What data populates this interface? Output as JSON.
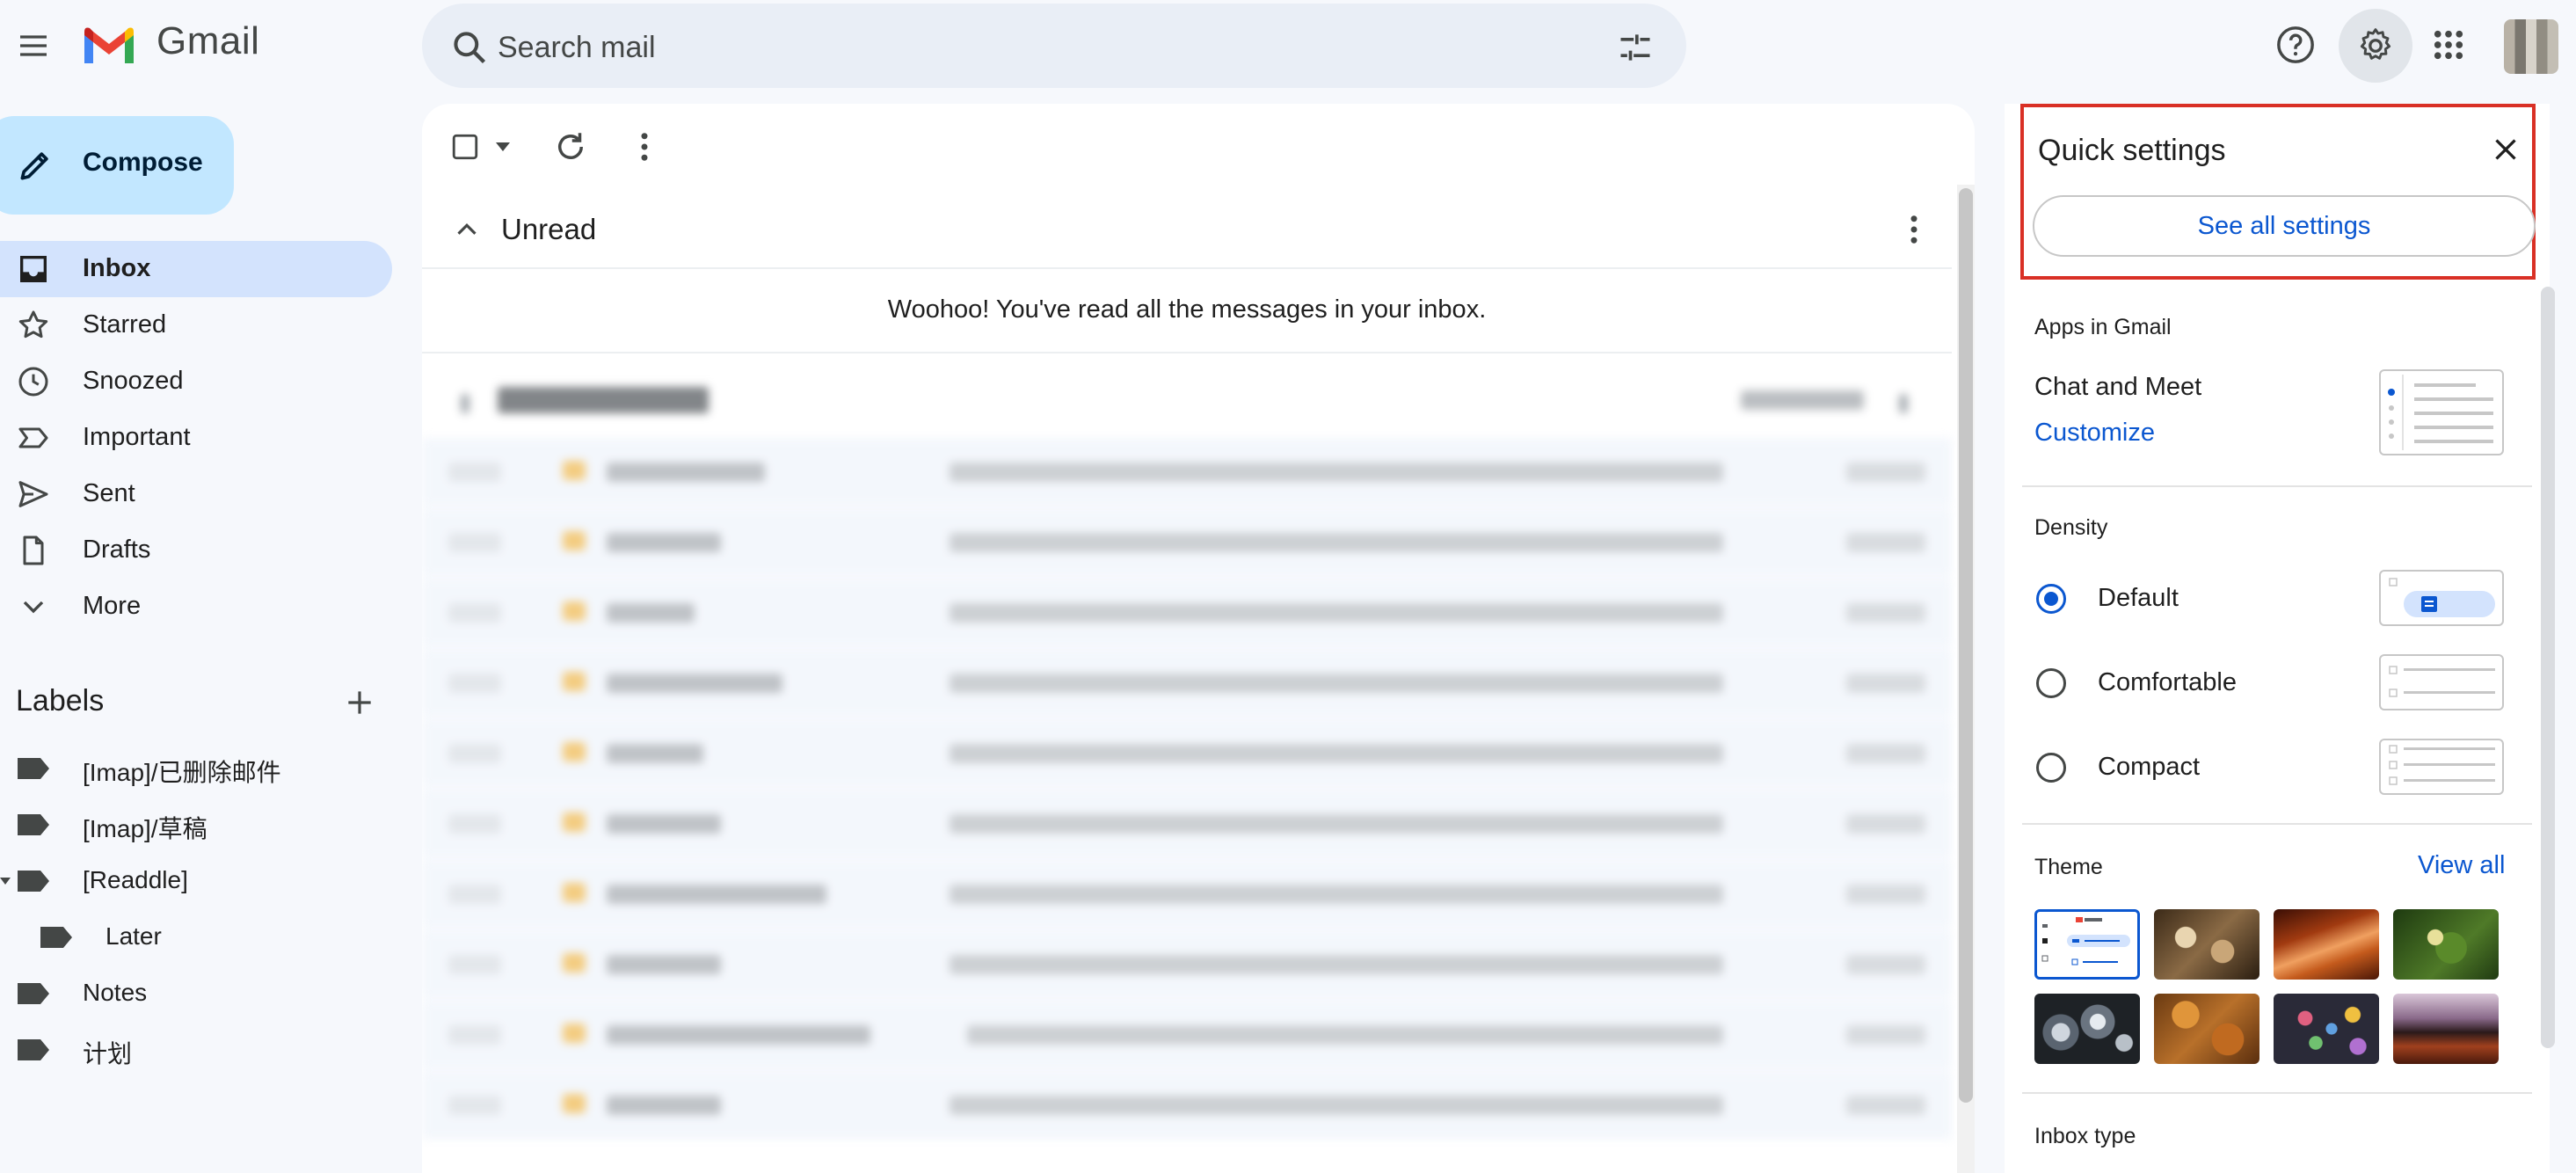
{
  "app": {
    "brand": "Gmail"
  },
  "header": {
    "search_placeholder": "Search mail",
    "icons": [
      "hamburger-menu-icon",
      "gmail-logo",
      "search-icon",
      "search-options-icon",
      "help-icon",
      "gear-icon",
      "apps-grid-icon",
      "avatar"
    ]
  },
  "compose": {
    "label": "Compose"
  },
  "nav": {
    "items": [
      {
        "label": "Inbox",
        "icon": "inbox-icon",
        "active": true
      },
      {
        "label": "Starred",
        "icon": "star-icon"
      },
      {
        "label": "Snoozed",
        "icon": "clock-icon"
      },
      {
        "label": "Important",
        "icon": "important-icon"
      },
      {
        "label": "Sent",
        "icon": "send-icon"
      },
      {
        "label": "Drafts",
        "icon": "draft-icon"
      },
      {
        "label": "More",
        "icon": "chevron-down-icon"
      }
    ]
  },
  "labels": {
    "title": "Labels",
    "items": [
      {
        "label": "[Imap]/已删除邮件"
      },
      {
        "label": "[Imap]/草稿"
      },
      {
        "label": "[Readdle]"
      },
      {
        "label": "Later"
      },
      {
        "label": "Notes"
      },
      {
        "label": "计划"
      }
    ]
  },
  "main": {
    "section_title": "Unread",
    "empty_message": "Woohoo! You've read all the messages in your inbox."
  },
  "quick_settings": {
    "title": "Quick settings",
    "see_all": "See all settings",
    "apps_heading": "Apps in Gmail",
    "chat_meet": "Chat and Meet",
    "customize": "Customize",
    "density_heading": "Density",
    "density_options": [
      "Default",
      "Comfortable",
      "Compact"
    ],
    "density_selected": "Default",
    "theme_heading": "Theme",
    "view_all": "View all",
    "inbox_type_heading": "Inbox type"
  },
  "colors": {
    "accent": "#0b57d0",
    "highlight_box": "#d93025",
    "compose_bg": "#c2e7ff",
    "active_nav": "#d3e3fd",
    "page_bg": "#f6f8fc"
  }
}
